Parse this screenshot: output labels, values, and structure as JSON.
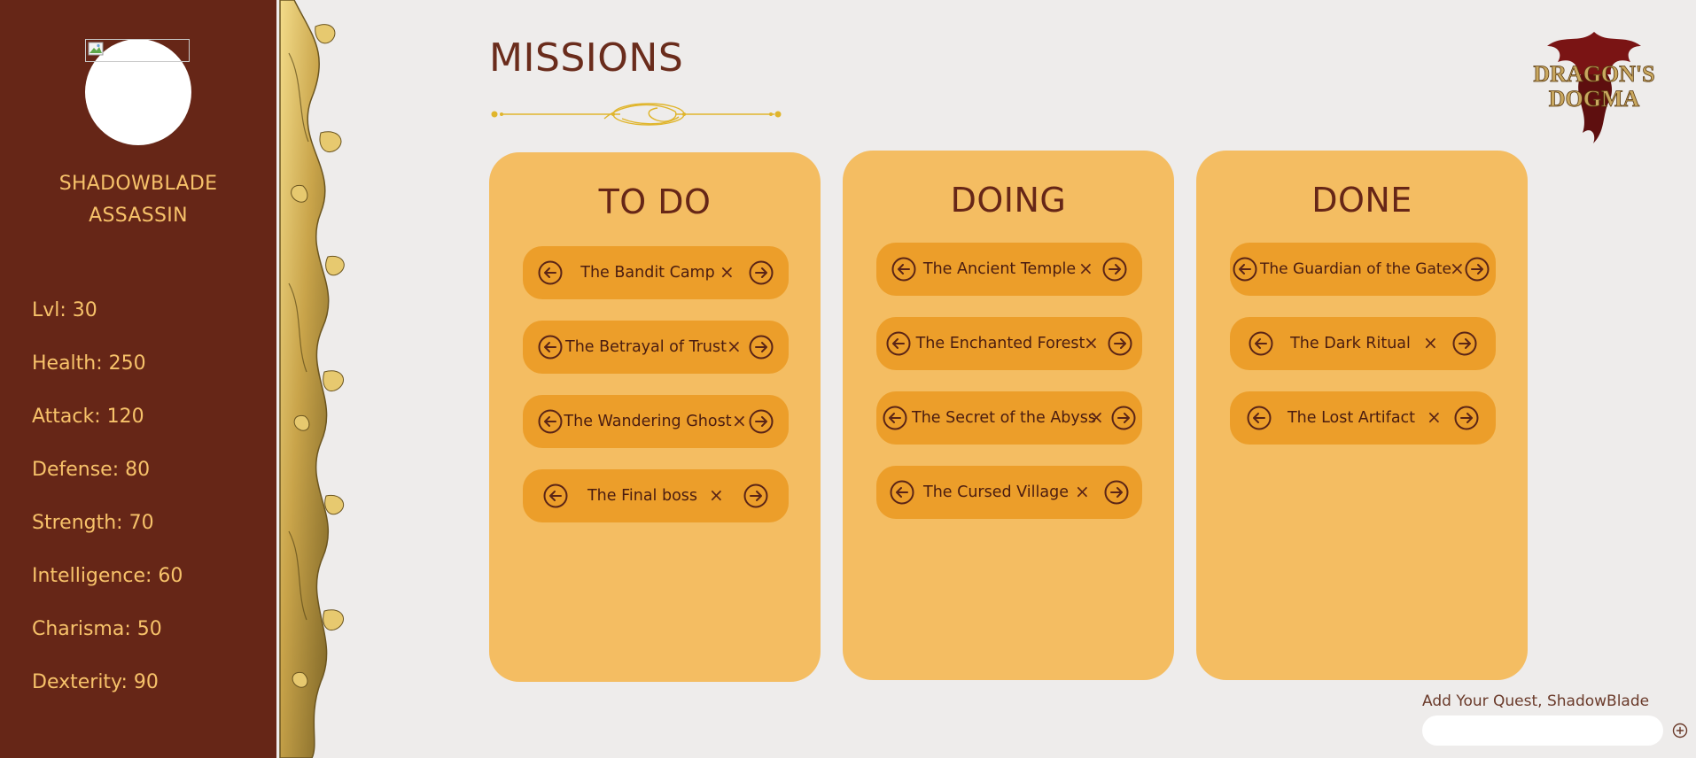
{
  "sidebar": {
    "character_name_line1": "SHADOWBLADE",
    "character_name_line2": "ASSASSIN",
    "stats": [
      "Lvl: 30",
      "Health: 250",
      "Attack: 120",
      "Defense: 80",
      "Strength: 70",
      "Intelligence: 60",
      "Charisma: 50",
      "Dexterity: 90"
    ]
  },
  "header": {
    "title": "MISSIONS",
    "logo_icon": "dragons-dogma-logo"
  },
  "columns": [
    {
      "title": "TO DO",
      "cards": [
        "The Bandit Camp",
        "The Betrayal of Trust",
        "The Wandering Ghost",
        "The Final boss"
      ]
    },
    {
      "title": "DOING",
      "cards": [
        "The Ancient Temple",
        "The Enchanted Forest",
        "The Secret of the Abyss",
        "The Cursed Village"
      ]
    },
    {
      "title": "DONE",
      "cards": [
        "The Guardian of the Gate",
        "The Dark Ritual",
        "The Lost Artifact"
      ]
    }
  ],
  "card_close_symbol": "×",
  "add_quest": {
    "label": "Add Your Quest, ShadowBlade",
    "input_value": "",
    "button_icon": "plus-circle-icon"
  },
  "colors": {
    "sidebar_bg": "#662617",
    "sidebar_text": "#f7c26a",
    "column_bg": "#f4bd62",
    "card_bg": "#ec9e2a",
    "title_text": "#6a2c1c",
    "page_bg": "#eeeceb"
  }
}
